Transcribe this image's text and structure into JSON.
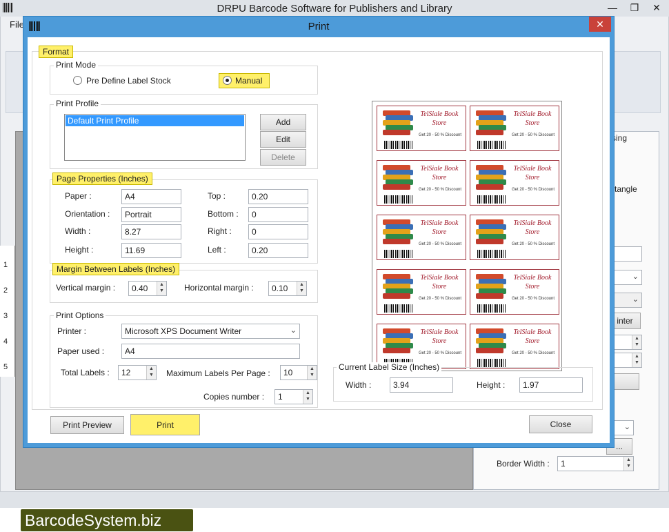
{
  "app": {
    "title": "DRPU Barcode Software for Publishers and Library",
    "menu_file": "File",
    "window_controls": [
      "minimize-icon",
      "restore-icon",
      "close-icon"
    ],
    "right_panel_fragments": {
      "tab": "sing",
      "shape": "tangle",
      "printer_btn": "inter",
      "border_width_label": "Border Width :",
      "border_width_value": "1"
    },
    "ruler_numbers": [
      "1",
      "2",
      "3",
      "4",
      "5"
    ]
  },
  "brand": "BarcodeSystem.biz",
  "dialog": {
    "title": "Print",
    "format_label": "Format",
    "print_mode": {
      "title": "Print Mode",
      "options": [
        "Pre Define Label Stock",
        "Manual"
      ],
      "selected": "Manual"
    },
    "print_profile": {
      "title": "Print Profile",
      "profiles": [
        "Default Print Profile"
      ],
      "add": "Add",
      "edit": "Edit",
      "delete": "Delete"
    },
    "page_properties": {
      "title": "Page Properties (Inches)",
      "paper_label": "Paper :",
      "paper": "A4",
      "orientation_label": "Orientation :",
      "orientation": "Portrait",
      "width_label": "Width :",
      "width": "8.27",
      "height_label": "Height :",
      "height": "11.69",
      "top_label": "Top :",
      "top": "0.20",
      "bottom_label": "Bottom :",
      "bottom": "0",
      "right_label": "Right :",
      "right": "0",
      "left_label": "Left :",
      "left": "0.20"
    },
    "margins": {
      "title": "Margin Between Labels (Inches)",
      "vertical_label": "Vertical margin :",
      "vertical": "0.40",
      "horizontal_label": "Horizontal margin :",
      "horizontal": "0.10"
    },
    "print_options": {
      "title": "Print Options",
      "printer_label": "Printer :",
      "printer": "Microsoft XPS Document Writer",
      "paper_used_label": "Paper used :",
      "paper_used": "A4",
      "total_labels_label": "Total Labels :",
      "total_labels": "12",
      "max_per_page_label": "Maximum Labels Per Page :",
      "max_per_page": "10",
      "copies_label": "Copies number :",
      "copies": "1"
    },
    "label_size": {
      "title": "Current Label Size (Inches)",
      "width_label": "Width :",
      "width": "3.94",
      "height_label": "Height :",
      "height": "1.97"
    },
    "label_preview": {
      "store_name": "TelSiale Book Store",
      "discount": "Get 20 - 50 % Discount",
      "count": 10
    },
    "buttons": {
      "preview": "Print Preview",
      "print": "Print",
      "close": "Close"
    }
  }
}
